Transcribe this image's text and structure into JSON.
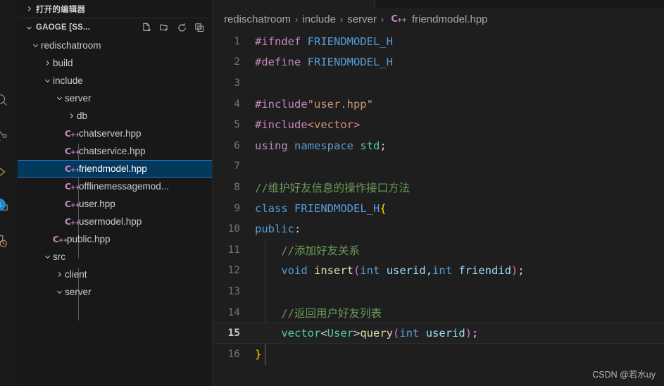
{
  "activity_bar": {
    "items": [
      {
        "name": "search-icon",
        "label": "Search"
      },
      {
        "name": "source-control-icon",
        "label": "Source Control"
      },
      {
        "name": "run-debug-icon",
        "label": "Run and Debug"
      },
      {
        "name": "extensions-icon",
        "label": "Extensions"
      },
      {
        "name": "remote-explorer-icon",
        "label": "Remote Explorer"
      }
    ],
    "badge": "1",
    "badge_color": "#1f8ad2"
  },
  "sidebar": {
    "open_editors": {
      "label": "打开的编辑器",
      "expanded": false
    },
    "workspace": {
      "label": "GAOGE [SS...",
      "expanded": true,
      "actions": [
        {
          "name": "new-file-icon",
          "label": "New File"
        },
        {
          "name": "new-folder-icon",
          "label": "New Folder"
        },
        {
          "name": "refresh-icon",
          "label": "Refresh Explorer"
        },
        {
          "name": "collapse-all-icon",
          "label": "Collapse Folders in Explorer"
        }
      ]
    },
    "tree": [
      {
        "label": "redischatroom",
        "depth": 1,
        "kind": "folder",
        "expanded": true
      },
      {
        "label": "build",
        "depth": 2,
        "kind": "folder",
        "expanded": false
      },
      {
        "label": "include",
        "depth": 2,
        "kind": "folder",
        "expanded": true
      },
      {
        "label": "server",
        "depth": 3,
        "kind": "folder",
        "expanded": true
      },
      {
        "label": "db",
        "depth": 4,
        "kind": "folder",
        "expanded": false
      },
      {
        "label": "chatserver.hpp",
        "depth": 4,
        "kind": "cpp"
      },
      {
        "label": "chatservice.hpp",
        "depth": 4,
        "kind": "cpp"
      },
      {
        "label": "friendmodel.hpp",
        "depth": 4,
        "kind": "cpp",
        "selected": true
      },
      {
        "label": "offlinemessagemod...",
        "depth": 4,
        "kind": "cpp"
      },
      {
        "label": "user.hpp",
        "depth": 4,
        "kind": "cpp"
      },
      {
        "label": "usermodel.hpp",
        "depth": 4,
        "kind": "cpp"
      },
      {
        "label": "public.hpp",
        "depth": 3,
        "kind": "cpp"
      },
      {
        "label": "src",
        "depth": 2,
        "kind": "folder",
        "expanded": true
      },
      {
        "label": "client",
        "depth": 3,
        "kind": "folder",
        "expanded": false
      },
      {
        "label": "server",
        "depth": 3,
        "kind": "folder",
        "expanded": true
      }
    ]
  },
  "breadcrumbs": {
    "items": [
      "redischatroom",
      "include",
      "server",
      "friendmodel.hpp"
    ],
    "separator": "›",
    "file_icon": "cpp-file-icon"
  },
  "editor": {
    "filename": "friendmodel.hpp",
    "active_line": 15,
    "lines": [
      {
        "n": 1,
        "tokens": [
          {
            "t": "#ifndef ",
            "c": "t-pre"
          },
          {
            "t": "FRIENDMODEL_H",
            "c": "t-macro"
          }
        ]
      },
      {
        "n": 2,
        "tokens": [
          {
            "t": "#define ",
            "c": "t-pre"
          },
          {
            "t": "FRIENDMODEL_H",
            "c": "t-macro"
          }
        ]
      },
      {
        "n": 3,
        "tokens": []
      },
      {
        "n": 4,
        "tokens": [
          {
            "t": "#include",
            "c": "t-pre"
          },
          {
            "t": "\"user.hpp\"",
            "c": "t-str"
          }
        ]
      },
      {
        "n": 5,
        "tokens": [
          {
            "t": "#include",
            "c": "t-pre"
          },
          {
            "t": "<vector>",
            "c": "t-str"
          }
        ]
      },
      {
        "n": 6,
        "tokens": [
          {
            "t": "using",
            "c": "t-kw2"
          },
          {
            "t": " ",
            "c": "t-plain"
          },
          {
            "t": "namespace",
            "c": "t-key"
          },
          {
            "t": " ",
            "c": "t-plain"
          },
          {
            "t": "std",
            "c": "t-type"
          },
          {
            "t": ";",
            "c": "t-plain"
          }
        ]
      },
      {
        "n": 7,
        "tokens": []
      },
      {
        "n": 8,
        "tokens": [
          {
            "t": "//维护好友信息的操作接口方法",
            "c": "t-cmt"
          }
        ]
      },
      {
        "n": 9,
        "tokens": [
          {
            "t": "class",
            "c": "t-key"
          },
          {
            "t": " ",
            "c": "t-plain"
          },
          {
            "t": "FRIENDMODEL_H",
            "c": "t-macro"
          },
          {
            "t": "{",
            "c": "t-brace"
          }
        ]
      },
      {
        "n": 10,
        "tokens": [
          {
            "t": "public",
            "c": "t-key"
          },
          {
            "t": ":",
            "c": "t-plain"
          }
        ]
      },
      {
        "n": 11,
        "tokens": [
          {
            "t": "    //添加好友关系",
            "c": "t-cmt"
          }
        ]
      },
      {
        "n": 12,
        "tokens": [
          {
            "t": "    ",
            "c": "t-plain"
          },
          {
            "t": "void",
            "c": "t-key"
          },
          {
            "t": " ",
            "c": "t-plain"
          },
          {
            "t": "insert",
            "c": "t-fn"
          },
          {
            "t": "(",
            "c": "t-paren"
          },
          {
            "t": "int",
            "c": "t-key"
          },
          {
            "t": " ",
            "c": "t-plain"
          },
          {
            "t": "userid",
            "c": "t-var"
          },
          {
            "t": ",",
            "c": "t-plain"
          },
          {
            "t": "int",
            "c": "t-key"
          },
          {
            "t": " ",
            "c": "t-plain"
          },
          {
            "t": "friendid",
            "c": "t-var"
          },
          {
            "t": ")",
            "c": "t-paren"
          },
          {
            "t": ";",
            "c": "t-plain"
          }
        ]
      },
      {
        "n": 13,
        "tokens": []
      },
      {
        "n": 14,
        "tokens": [
          {
            "t": "    //返回用户好友列表",
            "c": "t-cmt"
          }
        ]
      },
      {
        "n": 15,
        "tokens": [
          {
            "t": "    ",
            "c": "t-plain"
          },
          {
            "t": "vector",
            "c": "t-type"
          },
          {
            "t": "<",
            "c": "t-plain"
          },
          {
            "t": "User",
            "c": "t-type"
          },
          {
            "t": ">",
            "c": "t-plain"
          },
          {
            "t": "query",
            "c": "t-fn"
          },
          {
            "t": "(",
            "c": "t-paren"
          },
          {
            "t": "int",
            "c": "t-key"
          },
          {
            "t": " ",
            "c": "t-plain"
          },
          {
            "t": "userid",
            "c": "t-var"
          },
          {
            "t": ")",
            "c": "t-paren"
          },
          {
            "t": ";",
            "c": "t-plain"
          }
        ]
      },
      {
        "n": 16,
        "tokens": [
          {
            "t": "}",
            "c": "t-brace"
          }
        ]
      }
    ]
  },
  "watermark": "CSDN @若水uy",
  "theme": {
    "editor_bg": "#1e1e1e",
    "sidebar_bg": "#181818",
    "selection_bg": "#04395e",
    "selection_border": "#2a7fd4",
    "accent": "#1f8ad2"
  }
}
